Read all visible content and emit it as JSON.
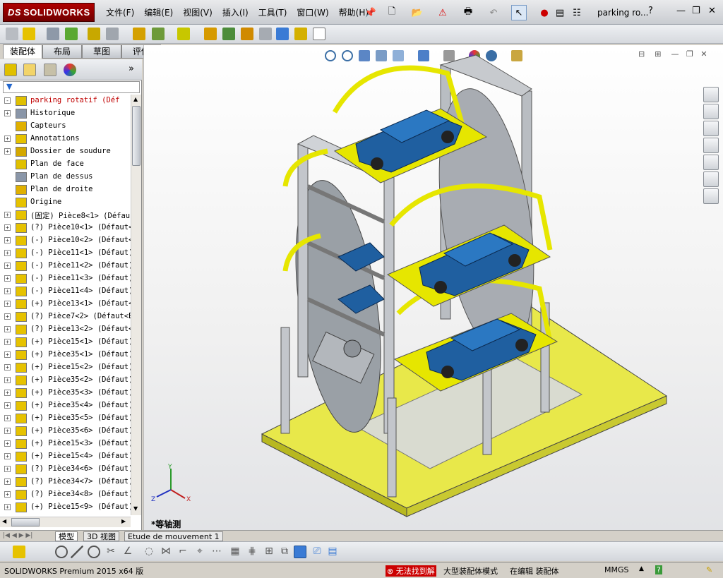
{
  "app": {
    "logo": "SOLIDWORKS",
    "logo_prefix": "DS",
    "document_title": "parking ro..."
  },
  "menu": [
    "文件(F)",
    "编辑(E)",
    "视图(V)",
    "插入(I)",
    "工具(T)",
    "窗口(W)",
    "帮助(H)"
  ],
  "tabs": [
    {
      "label": "装配体",
      "active": true
    },
    {
      "label": "布局",
      "active": false
    },
    {
      "label": "草图",
      "active": false
    },
    {
      "label": "评估",
      "active": false
    }
  ],
  "tree": [
    {
      "label": "parking rotatif  (Déf",
      "exp": "-",
      "color": "#c00000"
    },
    {
      "label": "Historique",
      "exp": "+"
    },
    {
      "label": "Capteurs",
      "exp": ""
    },
    {
      "label": "Annotations",
      "exp": "+"
    },
    {
      "label": "Dossier de soudure",
      "exp": "+"
    },
    {
      "label": "Plan de face",
      "exp": ""
    },
    {
      "label": "Plan de dessus",
      "exp": ""
    },
    {
      "label": "Plan de droite",
      "exp": ""
    },
    {
      "label": "Origine",
      "exp": ""
    },
    {
      "label": "(固定) Pièce8<1> (Défau",
      "exp": "+"
    },
    {
      "label": "(?) Pièce10<1> (Défaut<",
      "exp": "+"
    },
    {
      "label": "(-) Pièce10<2> (Défaut<",
      "exp": "+"
    },
    {
      "label": "(-) Pièce11<1> (Défaut)",
      "exp": "+"
    },
    {
      "label": "(-) Pièce11<2> (Défaut)",
      "exp": "+"
    },
    {
      "label": "(-) Pièce11<3> (Défaut)",
      "exp": "+"
    },
    {
      "label": "(-) Pièce11<4> (Défaut)",
      "exp": "+"
    },
    {
      "label": "(+) Pièce13<1> (Défaut<",
      "exp": "+"
    },
    {
      "label": "(?) Pièce7<2> (Défaut<B",
      "exp": "+"
    },
    {
      "label": "(?) Pièce13<2> (Défaut<",
      "exp": "+"
    },
    {
      "label": "(+) Pièce15<1> (Défaut)",
      "exp": "+"
    },
    {
      "label": "(+) Pièce35<1> (Défaut)",
      "exp": "+"
    },
    {
      "label": "(+) Pièce15<2> (Défaut)",
      "exp": "+"
    },
    {
      "label": "(+) Pièce35<2> (Défaut)",
      "exp": "+"
    },
    {
      "label": "(+) Pièce35<3> (Défaut)",
      "exp": "+"
    },
    {
      "label": "(+) Pièce35<4> (Défaut)",
      "exp": "+"
    },
    {
      "label": "(+) Pièce35<5> (Défaut)",
      "exp": "+"
    },
    {
      "label": "(+) Pièce35<6> (Défaut)",
      "exp": "+"
    },
    {
      "label": "(+) Pièce15<3> (Défaut)",
      "exp": "+"
    },
    {
      "label": "(+) Pièce15<4> (Défaut)",
      "exp": "+"
    },
    {
      "label": "(?) Pièce34<6> (Défaut)",
      "exp": "+"
    },
    {
      "label": "(?) Pièce34<7> (Défaut)",
      "exp": "+"
    },
    {
      "label": "(?) Pièce34<8> (Défaut)",
      "exp": "+"
    },
    {
      "label": "(+) Pièce15<9> (Défaut)",
      "exp": "+"
    }
  ],
  "viewport": {
    "view_label": "*等轴测",
    "axis_x": "X",
    "axis_y": "Y",
    "axis_z": "Z"
  },
  "bottom_tabs": [
    {
      "label": "模型",
      "active": true
    },
    {
      "label": "3D 视图",
      "active": false
    },
    {
      "label": "Etude de mouvement 1",
      "active": false
    }
  ],
  "status": {
    "product": "SOLIDWORKS Premium 2015 x64 版",
    "error": "无法找到解",
    "mode": "大型装配体模式",
    "editing": "在编辑 装配体",
    "units": "MMGS"
  },
  "colors": {
    "frame_yellow": "#e6e600",
    "car_blue": "#1f5fa0",
    "steel_gray": "#b9bdc2",
    "base_yellow": "#e8e84a"
  }
}
